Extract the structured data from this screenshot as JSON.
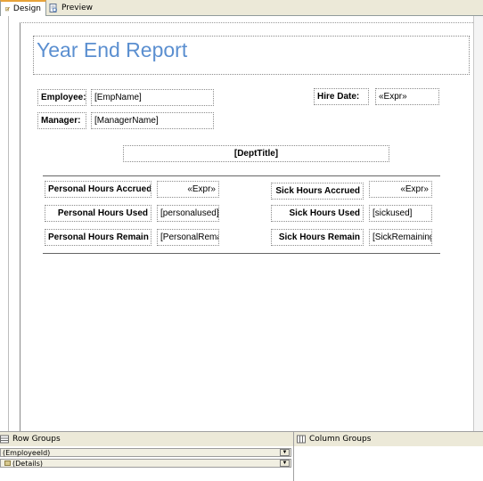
{
  "tabs": [
    {
      "label": "Design",
      "icon": "design-icon"
    },
    {
      "label": "Preview",
      "icon": "preview-icon"
    }
  ],
  "report": {
    "title": "Year End Report",
    "employee_label": "Employee:",
    "employee_value": "[EmpName]",
    "hire_date_label": "Hire Date:",
    "hire_date_value": "«Expr»",
    "manager_label": "Manager:",
    "manager_value": "[ManagerName]",
    "dept_title": "[DeptTitle]",
    "personal_accrued_label": "Personal Hours Accrued",
    "personal_accrued_value": "«Expr»",
    "sick_accrued_label": "Sick Hours Accrued",
    "sick_accrued_value": "«Expr»",
    "personal_used_label": "Personal Hours Used",
    "personal_used_value": "[personalused]",
    "sick_used_label": "Sick Hours Used",
    "sick_used_value": "[sickused]",
    "personal_remain_label": "Personal Hours Remain",
    "personal_remain_value": "[PersonalRemai",
    "sick_remain_label": "Sick Hours Remain",
    "sick_remain_value": "[SickRemaining"
  },
  "groups": {
    "row_groups_label": "Row Groups",
    "column_groups_label": "Column Groups",
    "row_items": [
      "(EmployeeId)",
      "(Details)"
    ]
  }
}
